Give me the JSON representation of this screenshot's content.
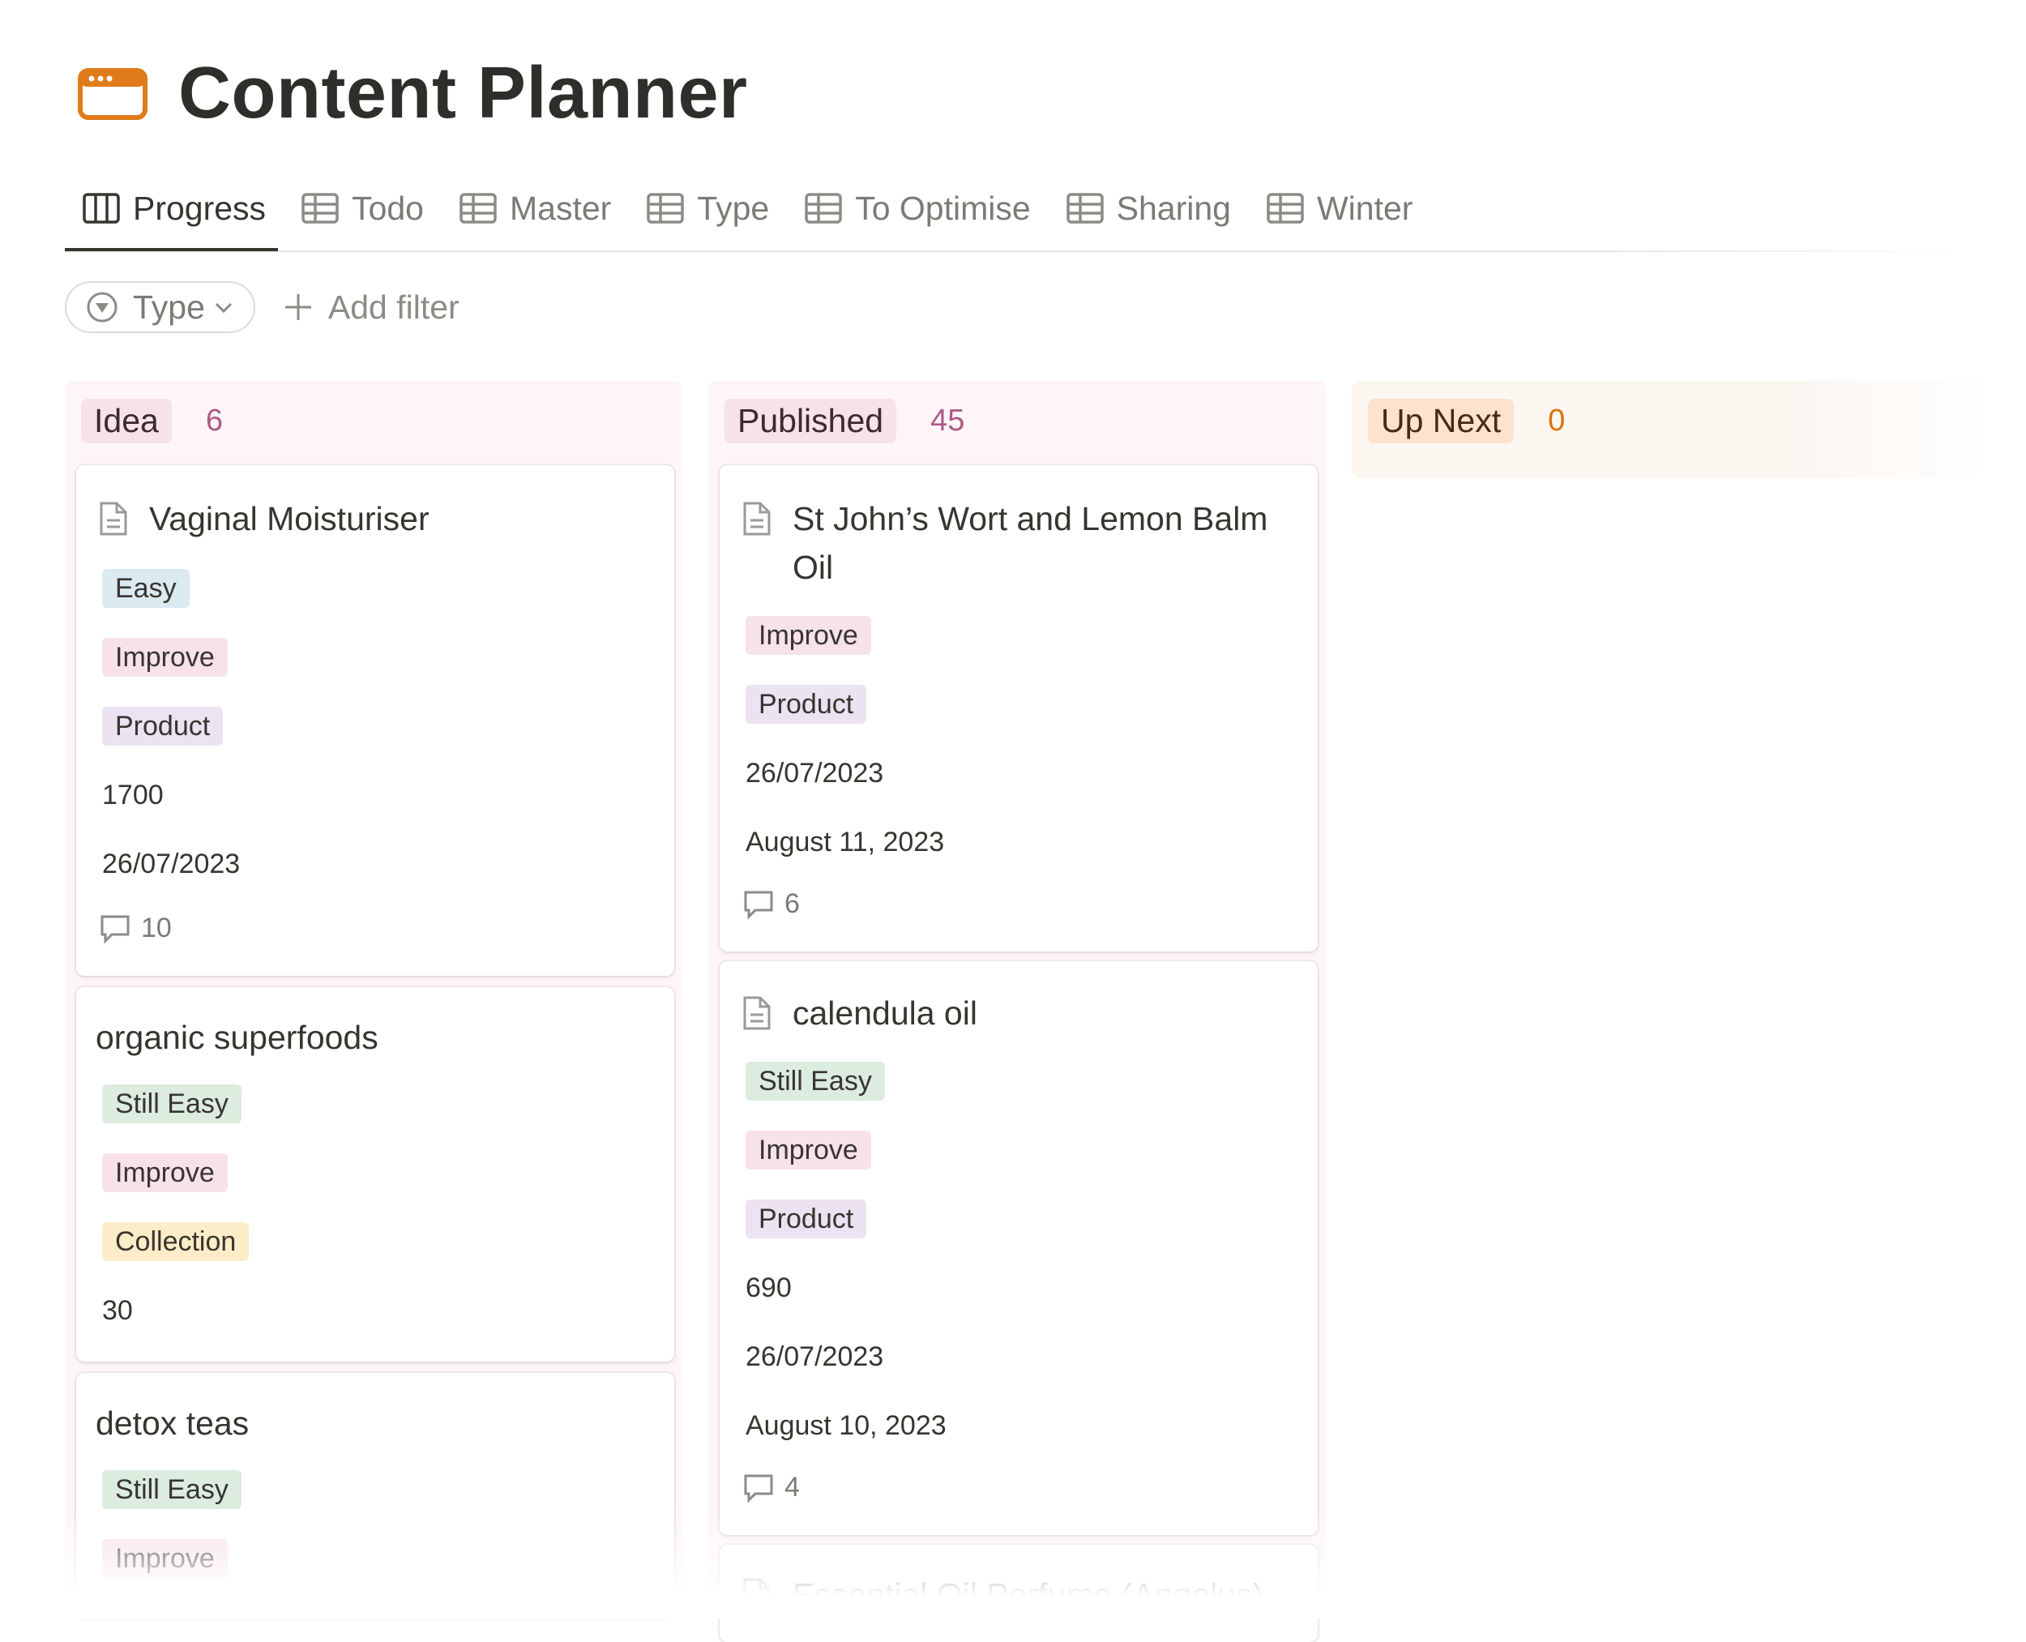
{
  "page": {
    "title": "Content Planner",
    "icon": "browser-window-icon",
    "accent": "#e67e22"
  },
  "tabs": [
    {
      "label": "Progress",
      "icon": "board-icon",
      "active": true
    },
    {
      "label": "Todo",
      "icon": "table-icon"
    },
    {
      "label": "Master",
      "icon": "table-icon"
    },
    {
      "label": "Type",
      "icon": "table-icon"
    },
    {
      "label": "To Optimise",
      "icon": "table-icon"
    },
    {
      "label": "Sharing",
      "icon": "table-icon"
    },
    {
      "label": "Winter",
      "icon": "table-icon"
    }
  ],
  "filters": {
    "pill_label": "Type",
    "add_label": "Add filter"
  },
  "columns": [
    {
      "label": "Idea",
      "count": "6",
      "label_bg": "#f7e1eb",
      "count_color": "#ad5a86",
      "cards": [
        {
          "title": "Vaginal Moisturiser",
          "tags": [
            "Easy",
            "Improve",
            "Product"
          ],
          "props": [
            "1700",
            "26/07/2023"
          ],
          "comments": "10"
        },
        {
          "title": "organic superfoods",
          "tags": [
            "Still Easy",
            "Improve",
            "Collection"
          ],
          "props": [
            "30"
          ]
        },
        {
          "title": "detox teas",
          "tags": [
            "Still Easy",
            "Improve"
          ]
        }
      ]
    },
    {
      "label": "Published",
      "count": "45",
      "label_bg": "#f7e1eb",
      "count_color": "#ad5a86",
      "cards": [
        {
          "title": "St John’s Wort and Lemon Balm Oil",
          "tags": [
            "Improve",
            "Product"
          ],
          "props": [
            "26/07/2023",
            "August 11, 2023"
          ],
          "comments": "6"
        },
        {
          "title": "calendula oil",
          "tags": [
            "Still Easy",
            "Improve",
            "Product"
          ],
          "props": [
            "690",
            "26/07/2023",
            "August 10, 2023"
          ],
          "comments": "4"
        },
        {
          "title": "Essential Oil Perfume (Angelus)"
        }
      ]
    },
    {
      "label": "Up Next",
      "count": "0",
      "label_bg": "#fbe3cf",
      "count_color": "#d9730d"
    }
  ]
}
